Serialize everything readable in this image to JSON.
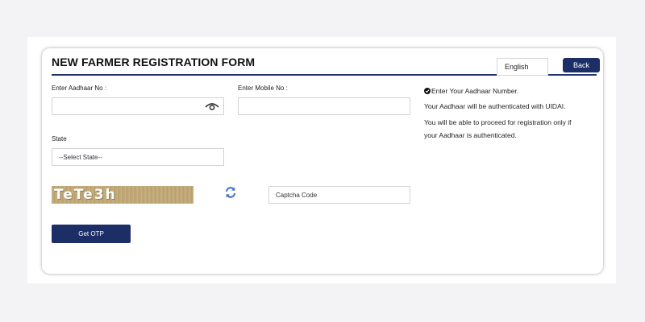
{
  "form": {
    "title": "NEW FARMER REGISTRATION FORM",
    "language": "English",
    "back_label": "Back",
    "aadhaar_label": "Enter Aadhaar No :",
    "mobile_label": "Enter Mobile No :",
    "state_label": "State",
    "state_selected": "--Select State--",
    "captcha_image_text": "TeTe3h",
    "captcha_placeholder": "Captcha Code",
    "get_otp_label": "Get OTP"
  },
  "info": {
    "line1": "Enter Your Aadhaar Number.",
    "line2": "Your Aadhaar will be authenticated with UIDAI.",
    "line3": "You will be able to proceed for registration only if",
    "line4": "your Aadhaar is authenticated."
  },
  "colors": {
    "primary": "#1c2e66",
    "background": "#f3f3f5",
    "refresh_icon": "#4a78c8"
  },
  "icons": {
    "eye": "eye-icon",
    "refresh": "refresh-icon",
    "check": "check-circle-icon"
  }
}
